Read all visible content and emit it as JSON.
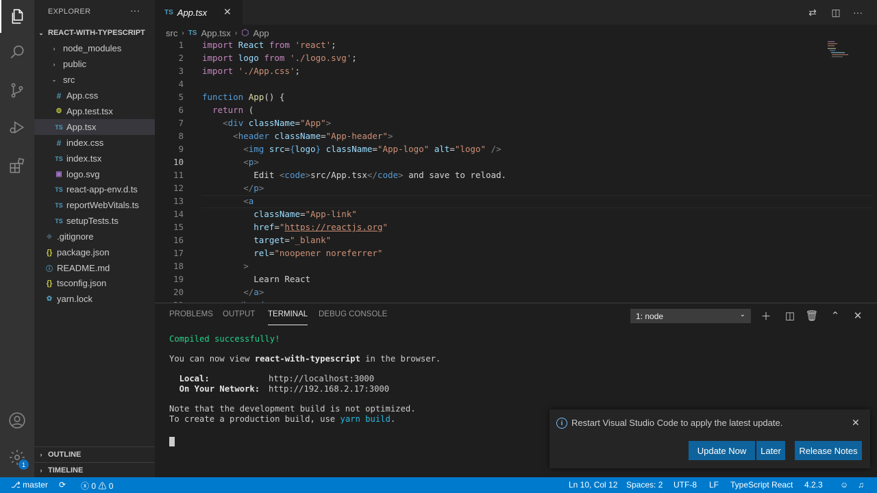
{
  "sidebar": {
    "title": "EXPLORER",
    "more": "···",
    "project": "REACT-WITH-TYPESCRIPT",
    "items": [
      {
        "label": "node_modules",
        "icon": "folder-icon"
      },
      {
        "label": "public",
        "icon": "folder-icon"
      },
      {
        "label": "src",
        "icon": "folder-open-icon"
      },
      {
        "label": "App.css",
        "icon": "css-file-icon"
      },
      {
        "label": "App.test.tsx",
        "icon": "test-file-icon"
      },
      {
        "label": "App.tsx",
        "icon": "ts-file-icon"
      },
      {
        "label": "index.css",
        "icon": "css-file-icon"
      },
      {
        "label": "index.tsx",
        "icon": "ts-file-icon"
      },
      {
        "label": "logo.svg",
        "icon": "svg-file-icon"
      },
      {
        "label": "react-app-env.d.ts",
        "icon": "ts-file-icon"
      },
      {
        "label": "reportWebVitals.ts",
        "icon": "ts-file-icon"
      },
      {
        "label": "setupTests.ts",
        "icon": "ts-file-icon"
      },
      {
        "label": ".gitignore",
        "icon": "git-file-icon"
      },
      {
        "label": "package.json",
        "icon": "json-file-icon"
      },
      {
        "label": "README.md",
        "icon": "info-file-icon"
      },
      {
        "label": "tsconfig.json",
        "icon": "json-file-icon"
      },
      {
        "label": "yarn.lock",
        "icon": "yarn-file-icon"
      }
    ],
    "outline": "OUTLINE",
    "timeline": "TIMELINE"
  },
  "activity": {
    "badge": "1"
  },
  "editor": {
    "tab": {
      "lang": "TS",
      "name": "App.tsx",
      "close": "✕"
    },
    "breadcrumb": {
      "folder": "src",
      "lang": "TS",
      "file": "App.tsx",
      "symbol": "App"
    },
    "current_line": 10
  },
  "panel": {
    "tabs": [
      "PROBLEMS",
      "OUTPUT",
      "TERMINAL",
      "DEBUG CONSOLE"
    ],
    "active_tab": "TERMINAL",
    "terminal_select": "1: node",
    "terminal": {
      "compiled": "Compiled successfully!",
      "view_pre": "You can now view ",
      "app_name": "react-with-typescript",
      "view_post": " in the browser.",
      "local_label": "  Local:",
      "local_url": "http://localhost:3000",
      "network_label": "  On Your Network:",
      "network_url": "http://192.168.2.17:3000",
      "note1": "Note that the development build is not optimized.",
      "note2_pre": "To create a production build, use ",
      "note2_cmd": "yarn build",
      "note2_post": "."
    }
  },
  "notification": {
    "message": "Restart Visual Studio Code to apply the latest update.",
    "buttons": [
      "Update Now",
      "Later",
      "Release Notes"
    ]
  },
  "status": {
    "branch": "master",
    "errors": "0",
    "warnings": "0",
    "position": "Ln 10, Col 12",
    "spaces": "Spaces: 2",
    "encoding": "UTF-8",
    "eol": "LF",
    "language": "TypeScript React",
    "version": "4.2.3"
  },
  "colors": {
    "accent": "#007acc",
    "button": "#0e639c",
    "editor_bg": "#1e1e1e",
    "sidebar_bg": "#252526"
  }
}
